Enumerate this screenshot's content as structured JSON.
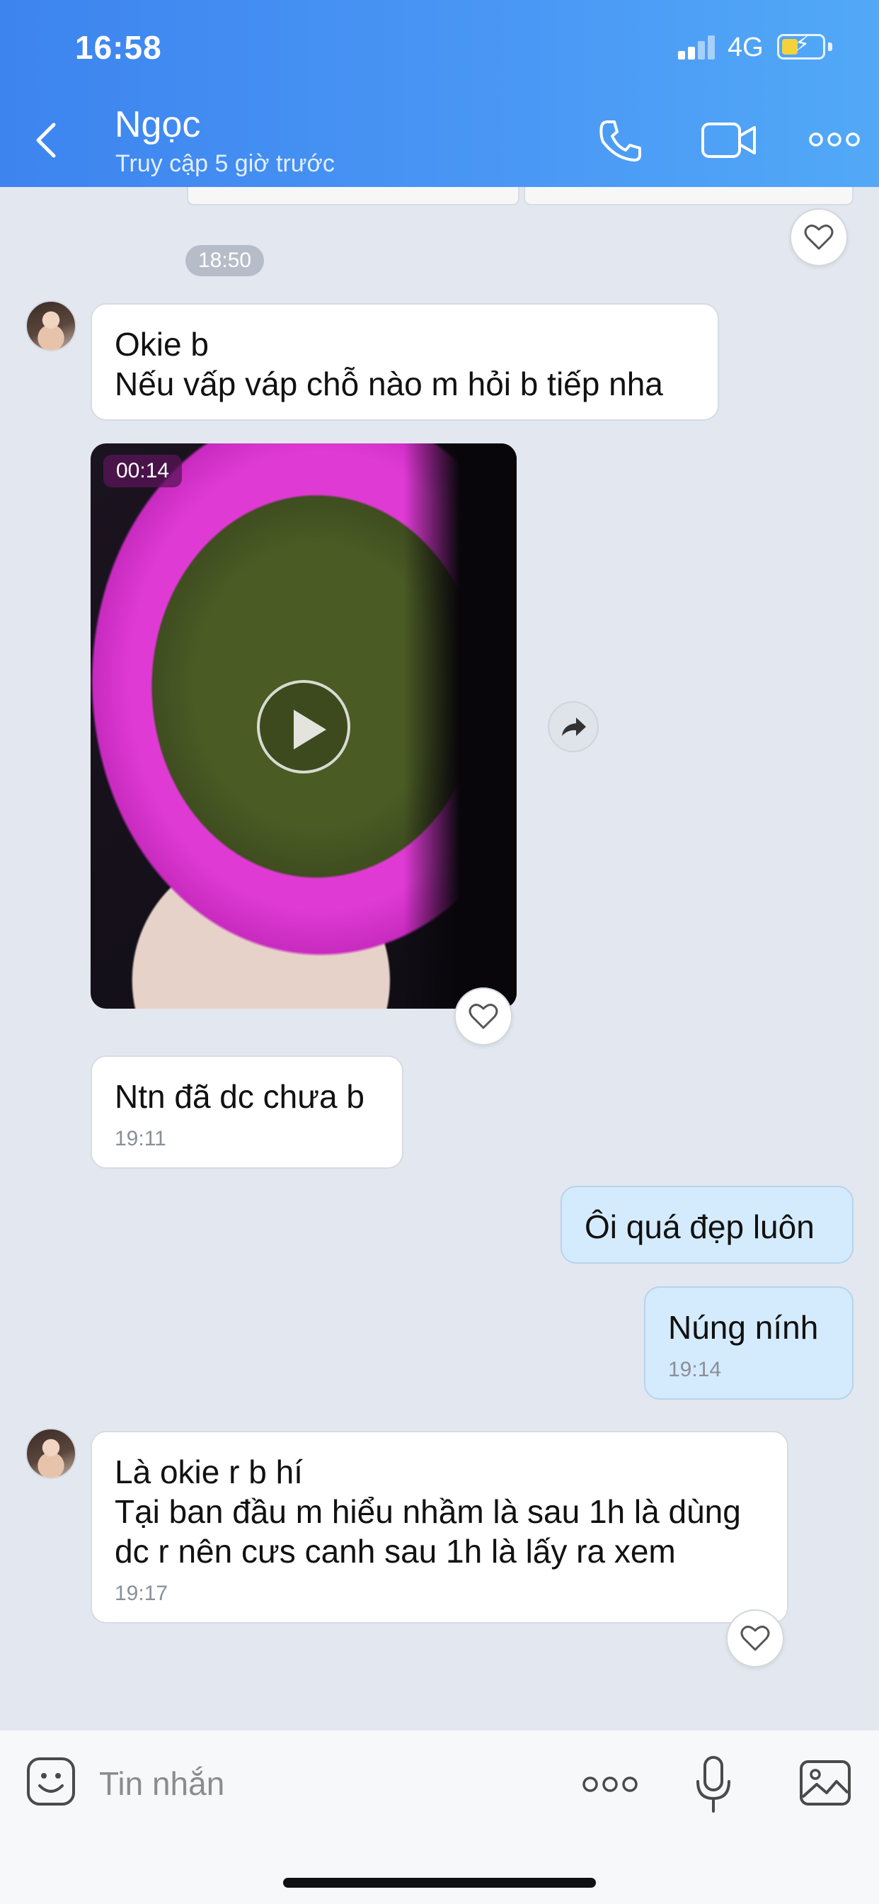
{
  "status_bar": {
    "time": "16:58",
    "network": "4G"
  },
  "header": {
    "name": "Ngọc",
    "subtitle": "Truy cập 5 giờ trước"
  },
  "chat": {
    "time_pill": "18:50",
    "messages": [
      {
        "sender": "them",
        "lines": [
          "Okie b",
          "Nếu vấp váp chỗ nào m hỏi b tiếp nha"
        ]
      },
      {
        "sender": "them",
        "type": "video",
        "duration": "00:14"
      },
      {
        "sender": "them",
        "lines": [
          "Ntn đã dc chưa b"
        ],
        "time": "19:11"
      },
      {
        "sender": "me",
        "lines": [
          "Ôi quá đẹp luôn"
        ]
      },
      {
        "sender": "me",
        "lines": [
          "Núng nính"
        ],
        "time": "19:14"
      },
      {
        "sender": "them",
        "lines": [
          "Là okie r b hí",
          "Tại ban đầu m hiểu nhầm là sau 1h là dùng",
          "dc r nên cưs canh sau 1h là lấy ra xem"
        ],
        "time": "19:17"
      }
    ]
  },
  "composer": {
    "placeholder": "Tin nhắn"
  },
  "colors": {
    "header": "#4a98f5",
    "chat_bg": "#e3e7ef",
    "my_bubble": "#d4ebfd"
  }
}
